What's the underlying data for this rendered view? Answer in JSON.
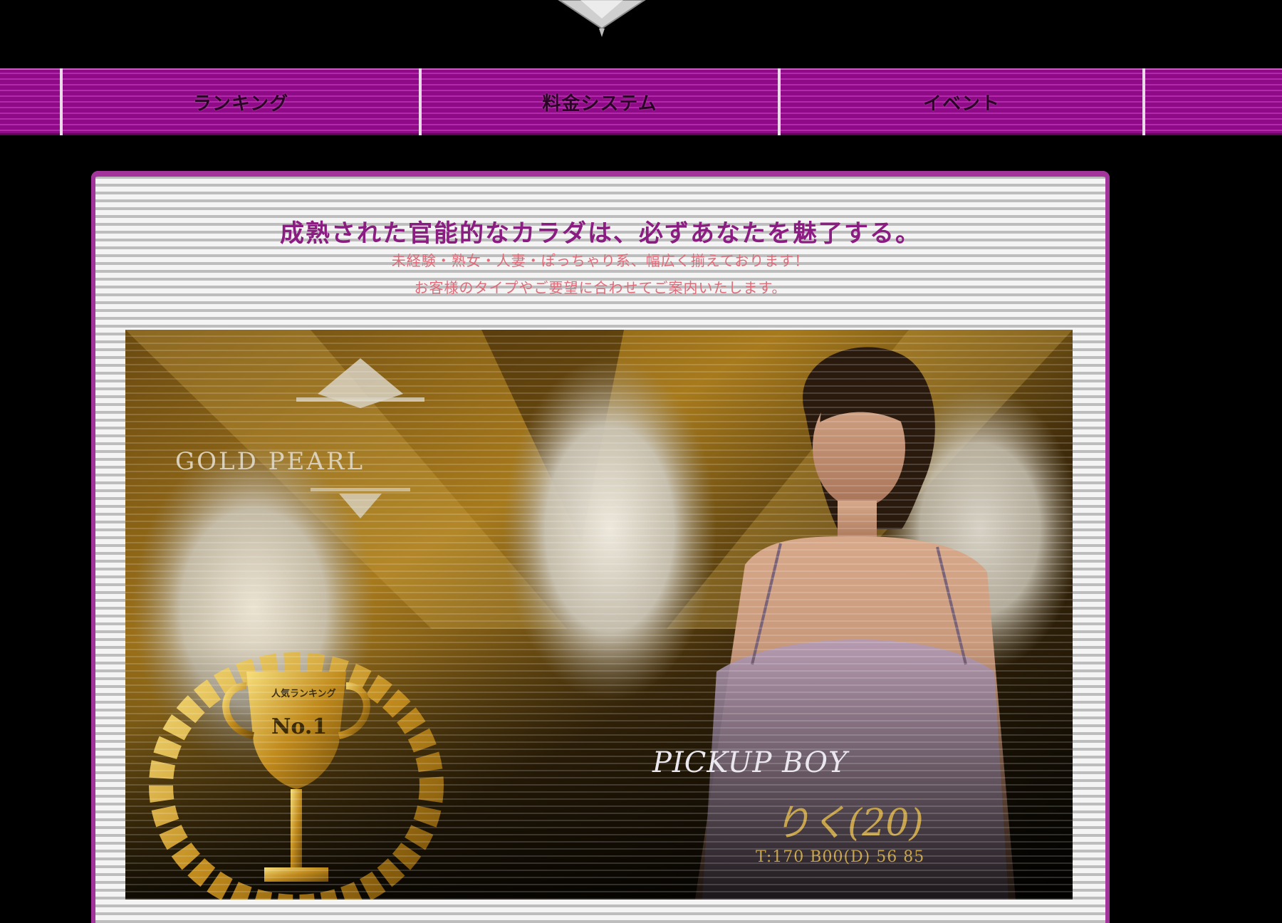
{
  "nav": {
    "items": [
      {
        "label": "ランキング"
      },
      {
        "label": "料金システム"
      },
      {
        "label": "イベント"
      }
    ]
  },
  "intro": {
    "tagline": "成熟された官能的なカラダは、必ずあなたを魅了する。",
    "sub1": "未経験・熟女・人妻・ぽっちゃり系、幅広く揃えております！",
    "sub2": "お客様のタイプやご要望に合わせてご案内いたします。"
  },
  "hero": {
    "brand": "GOLD PEARL",
    "trophy_caption": "人気ランキング",
    "trophy_rank": "No.1",
    "pickup_label": "PICKUP BOY",
    "pickup_name": "りく(20)",
    "pickup_stats": "T:170 B00(D) 56 85"
  },
  "colors": {
    "nav_bg": "#8e0a86",
    "accent": "#a3349c",
    "tagline": "#8b1c82",
    "sub_text": "#e06a78",
    "gold": "#c6a34a"
  }
}
